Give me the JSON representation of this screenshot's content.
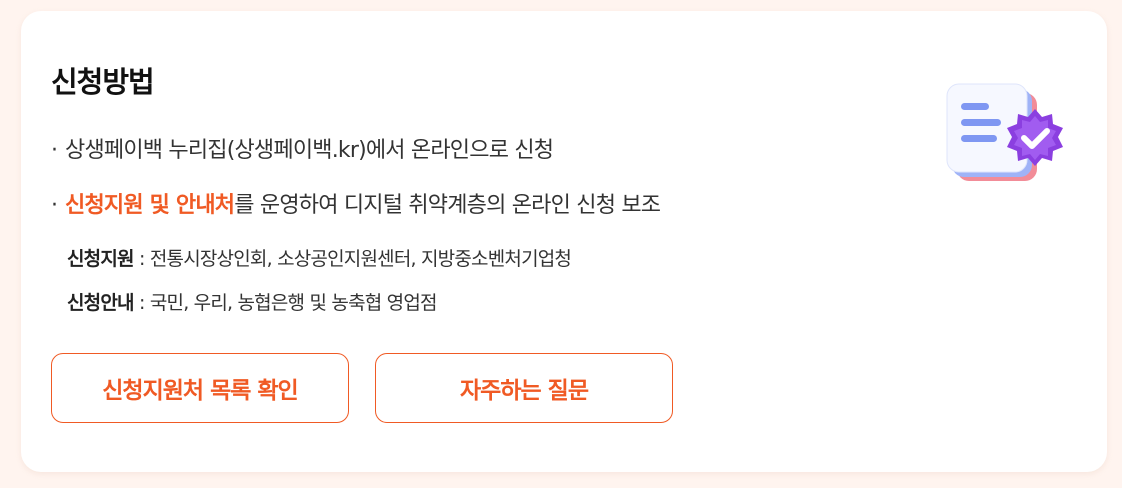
{
  "section": {
    "title": "신청방법"
  },
  "bullets": [
    {
      "dot": "·",
      "text": "상생페이백 누리집(상생페이백.kr)에서 온라인으로 신청"
    },
    {
      "dot": "·",
      "highlight": "신청지원 및 안내처",
      "text": "를 운영하여 디지털 취약계층의 온라인 신청 보조"
    }
  ],
  "details": [
    {
      "label": "신청지원",
      "sep": " : ",
      "text": "전통시장상인회, 소상공인지원센터, 지방중소벤처기업청"
    },
    {
      "label": "신청안내",
      "sep": " : ",
      "text": "국민, 우리, 농협은행 및 농축협 영업점"
    }
  ],
  "buttons": {
    "list_label": "신청지원처 목록 확인",
    "faq_label": "자주하는 질문"
  },
  "illustration": {
    "icon": "verified-document-icon"
  },
  "colors": {
    "accent": "#f05a24",
    "background": "#fff4ef",
    "badge": "#8b3fe0"
  }
}
